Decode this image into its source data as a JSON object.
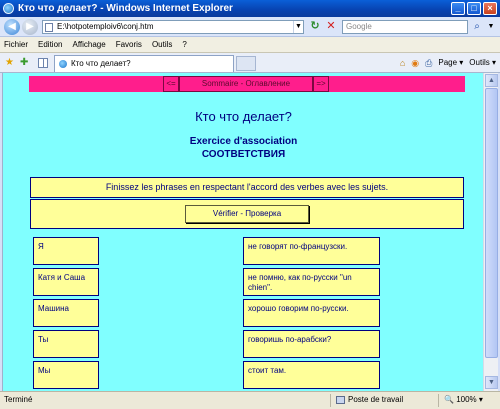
{
  "window": {
    "title": "Кто что делает? - Windows Internet Explorer"
  },
  "address_bar": {
    "url": "E:\\hotpotemploiv6\\conj.htm",
    "search_placeholder": "Google"
  },
  "menu": [
    "Fichier",
    "Edition",
    "Affichage",
    "Favoris",
    "Outils",
    "?"
  ],
  "tab": {
    "label": "Кто что делает?"
  },
  "commands": {
    "page": "Page",
    "tools": "Outils"
  },
  "page": {
    "nav": {
      "prev": "<=",
      "contents": "Sommaire - Оглавление",
      "next": "=>"
    },
    "title": "Кто что делает?",
    "subtitle_fr": "Exercice d'association",
    "subtitle_ru": "СООТВЕТСТВИЯ",
    "instructions": "Finissez les phrases en respectant l'accord des verbes avec les sujets.",
    "check_button": "Vérifier - Проверка",
    "subjects": [
      "Я",
      "Катя и Саша",
      "Машина",
      "Ты",
      "Мы"
    ],
    "endings": [
      "не говорят по-французски.",
      "не помню, как по-русски \"un chien\".",
      "хорошо говорим по-русски.",
      "говоришь по-арабски?",
      "стоит там."
    ]
  },
  "status": {
    "left": "Terminé",
    "zone": "Poste de travail",
    "zoom": "100%"
  }
}
